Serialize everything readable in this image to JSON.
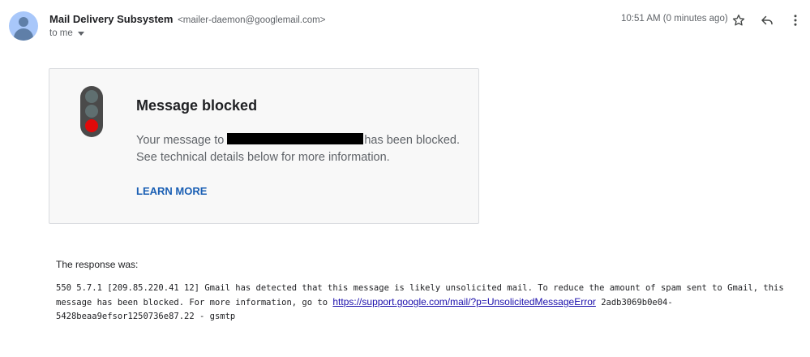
{
  "header": {
    "sender_name": "Mail Delivery Subsystem",
    "sender_email": "<mailer-daemon@googlemail.com>",
    "recipient": "to me",
    "timestamp": "10:51 AM (0 minutes ago)",
    "icons": [
      "star-icon",
      "reply-icon",
      "more-vert-icon"
    ]
  },
  "card": {
    "title": "Message blocked",
    "body_prefix": "Your message to",
    "body_suffix": "has been blocked.",
    "body_line2": "See technical details below for more information.",
    "learn_more": "LEARN MORE",
    "traffic_light_colors": [
      "#5f6f70",
      "#5f6f70",
      "#e00a0a"
    ]
  },
  "response": {
    "label": "The response was:",
    "text_before_link": "550 5.7.1 [209.85.220.41 12] Gmail has detected that this message is likely unsolicited mail. To reduce the amount of spam sent to Gmail, this message has been blocked. For more information, go to",
    "link": "https://support.google.com/mail/?p=UnsolicitedMessageError",
    "text_after_link": "2adb3069b0e04-5428beaa9efsor1250736e87.22 - gsmtp"
  }
}
